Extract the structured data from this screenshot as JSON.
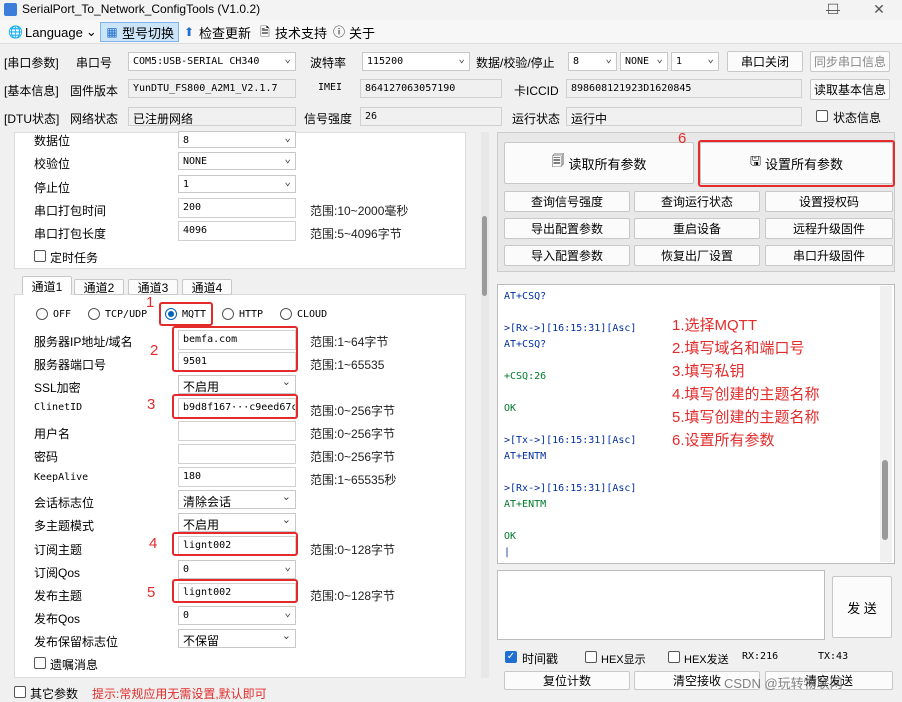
{
  "window": {
    "title": "SerialPort_To_Network_ConfigTools (V1.0.2)",
    "min": "—",
    "max": "☐",
    "close": "✕"
  },
  "menu": {
    "language": "Language",
    "model_switch": "型号切换",
    "check_update": "检查更新",
    "support": "技术支持",
    "about": "关于"
  },
  "row1": {
    "tag": "[串口参数]",
    "port_label": "串口号",
    "port_value": "COM5:USB-SERIAL CH340",
    "baud_label": "波特率",
    "baud_value": "115200",
    "dcs_label": "数据/校验/停止",
    "data_bits": "8",
    "parity": "NONE",
    "stop_bits": "1",
    "close_port": "串口关闭",
    "sync_port": "同步串口信息"
  },
  "row2": {
    "tag": "[基本信息]",
    "fw_label": "固件版本",
    "fw_value": "YunDTU_FS800_A2M1_V2.1.7",
    "imei_label": "IMEI",
    "imei_value": "864127063057190",
    "iccid_label": "卡ICCID",
    "iccid_value": "898608121923D1620845",
    "read_basic": "读取基本信息"
  },
  "row3": {
    "tag": "[DTU状态]",
    "net_label": "网络状态",
    "net_value": "已注册网络",
    "signal_label": "信号强度",
    "signal_value": "26",
    "run_label": "运行状态",
    "run_value": "运行中",
    "status_info": "状态信息"
  },
  "serial_cfg": {
    "data_bits_label": "数据位",
    "data_bits": "8",
    "parity_label": "校验位",
    "parity": "NONE",
    "stop_label": "停止位",
    "stop": "1",
    "pack_time_label": "串口打包时间",
    "pack_time": "200",
    "pack_time_range": "范围:10~2000毫秒",
    "pack_len_label": "串口打包长度",
    "pack_len": "4096",
    "pack_len_range": "范围:5~4096字节",
    "timer_task": "定时任务"
  },
  "tabs": [
    "通道1",
    "通道2",
    "通道3",
    "通道4"
  ],
  "protocols": [
    "OFF",
    "TCP/UDP",
    "MQTT",
    "HTTP",
    "CLOUD"
  ],
  "mqtt": {
    "server_label": "服务器IP地址/域名",
    "server": "bemfa.com",
    "server_range": "范围:1~64字节",
    "port_label": "服务器端口号",
    "port": "9501",
    "port_range": "范围:1~65535",
    "ssl_label": "SSL加密",
    "ssl": "不启用",
    "clientid_label": "ClinetID",
    "clientid": "b9d8f167···c9eed67c",
    "clientid_range": "范围:0~256字节",
    "user_label": "用户名",
    "user": "",
    "user_range": "范围:0~256字节",
    "pwd_label": "密码",
    "pwd": "",
    "pwd_range": "范围:0~256字节",
    "keepalive_label": "KeepAlive",
    "keepalive": "180",
    "keepalive_range": "范围:1~65535秒",
    "session_label": "会话标志位",
    "session": "清除会话",
    "multi_label": "多主题模式",
    "multi": "不启用",
    "sub_label": "订阅主题",
    "sub": "lignt002",
    "sub_range": "范围:0~128字节",
    "subqos_label": "订阅Qos",
    "subqos": "0",
    "pub_label": "发布主题",
    "pub": "lignt002",
    "pub_range": "范围:0~128字节",
    "pubqos_label": "发布Qos",
    "pubqos": "0",
    "retain_label": "发布保留标志位",
    "retain": "不保留",
    "will_label": "遗嘱消息"
  },
  "bottom": {
    "other_params": "其它参数",
    "tip": "提示:常规应用无需设置,默认即可"
  },
  "markers": [
    "1",
    "2",
    "3",
    "4",
    "5",
    "6"
  ],
  "actions": {
    "read_all": "读取所有参数",
    "set_all": "设置所有参数",
    "query_signal": "查询信号强度",
    "query_run": "查询运行状态",
    "set_auth": "设置授权码",
    "export_cfg": "导出配置参数",
    "restart": "重启设备",
    "remote_upgrade": "远程升级固件",
    "import_cfg": "导入配置参数",
    "factory": "恢复出厂设置",
    "serial_upgrade": "串口升级固件"
  },
  "terminal": [
    "AT+CSQ?",
    "",
    "",
    "",
    ">[Rx->][16:15:31][Asc]",
    "AT+CSQ?",
    "",
    "+CSQ:26",
    "",
    "OK",
    "",
    "",
    ">[Tx->][16:15:31][Asc]",
    "AT+ENTM",
    "",
    "",
    ">[Rx->][16:15:31][Asc]",
    "AT+ENTM",
    "",
    "",
    "OK",
    "|"
  ],
  "steps": [
    "1.选择MQTT",
    "2.填写域名和端口号",
    "3.填写私钥",
    "4.填写创建的主题名称",
    "5.填写创建的主题名称",
    "6.设置所有参数"
  ],
  "send": {
    "send_btn": "发 送",
    "timestamp": "时间戳",
    "hex_show": "HEX显示",
    "hex_send": "HEX发送",
    "rx": "RX:216",
    "tx": "TX:43",
    "reset_count": "复位计数",
    "clear_rx": "清空接收",
    "clear_tx": "清空发送"
  },
  "watermark": "CSDN @玩转物联网"
}
